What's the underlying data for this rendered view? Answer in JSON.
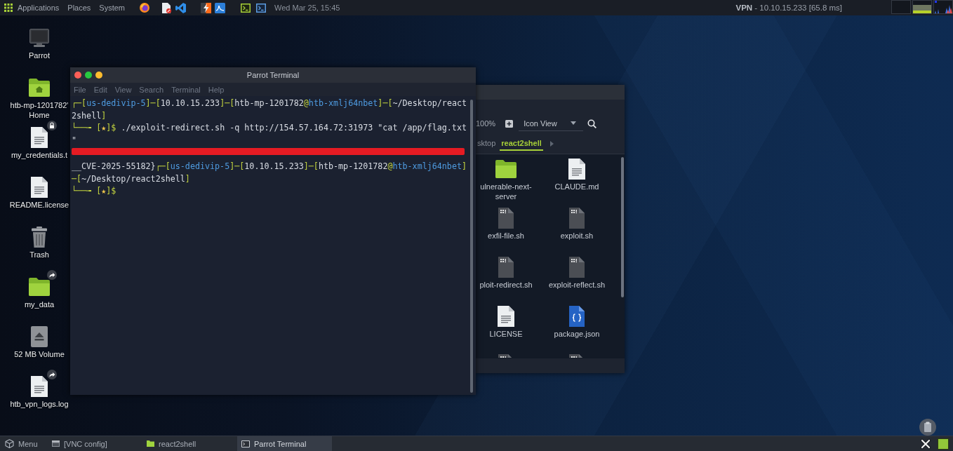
{
  "top_panel": {
    "menus": [
      "Applications",
      "Places",
      "System"
    ],
    "clock": "Wed Mar 25, 15:45",
    "vpn_status": "**VPN** - 10.10.15.233 [65.8 ms]"
  },
  "desktop_icons": [
    {
      "label": "Parrot",
      "kind": "computer",
      "locked": false,
      "linked": false
    },
    {
      "label": "htb-mp-1201782' Home",
      "kind": "home",
      "locked": false,
      "linked": false
    },
    {
      "label": "my_credentials.t",
      "kind": "document",
      "locked": true,
      "linked": false
    },
    {
      "label": "README.license",
      "kind": "document",
      "locked": false,
      "linked": false
    },
    {
      "label": "Trash",
      "kind": "trash",
      "locked": false,
      "linked": false
    },
    {
      "label": "my_data",
      "kind": "folder",
      "locked": false,
      "linked": true
    },
    {
      "label": "52 MB Volume",
      "kind": "volume",
      "locked": false,
      "linked": false
    },
    {
      "label": "htb_vpn_logs.log",
      "kind": "document",
      "locked": false,
      "linked": true
    }
  ],
  "terminal": {
    "title": "Parrot Terminal",
    "menu": [
      "File",
      "Edit",
      "View",
      "Search",
      "Terminal",
      "Help"
    ],
    "lines": [
      {
        "kind": "text",
        "segments": [
          {
            "kind": "frame",
            "text": "┌─["
          },
          {
            "kind": "host",
            "text": "us-dedivip-5"
          },
          {
            "kind": "frame",
            "text": "]─["
          },
          {
            "kind": "plain",
            "text": "10.10.15.233"
          },
          {
            "kind": "frame",
            "text": "]─["
          },
          {
            "kind": "plain",
            "text": "htb-mp-1201782"
          },
          {
            "kind": "frame",
            "text": "@"
          },
          {
            "kind": "host",
            "text": "htb-xmlj64nbet"
          },
          {
            "kind": "frame",
            "text": "]─["
          },
          {
            "kind": "plain",
            "text": "~/Desktop/react"
          }
        ]
      },
      {
        "kind": "text",
        "segments": [
          {
            "kind": "plain",
            "text": "2shell"
          },
          {
            "kind": "frame",
            "text": "]"
          }
        ]
      },
      {
        "kind": "text",
        "segments": [
          {
            "kind": "frame",
            "text": "└──╼ ["
          },
          {
            "kind": "star",
            "text": "★"
          },
          {
            "kind": "frame",
            "text": "]$"
          },
          {
            "kind": "plain",
            "text": " ./exploit-redirect.sh -q http://154.57.164.72:31973 \"cat /app/flag.txt"
          }
        ]
      },
      {
        "kind": "text",
        "segments": [
          {
            "kind": "plain",
            "text": "\""
          }
        ]
      },
      {
        "kind": "redacted"
      },
      {
        "kind": "text",
        "segments": [
          {
            "kind": "plain",
            "text": "__CVE-2025-55182}"
          },
          {
            "kind": "frame",
            "text": "┌─["
          },
          {
            "kind": "host",
            "text": "us-dedivip-5"
          },
          {
            "kind": "frame",
            "text": "]─["
          },
          {
            "kind": "plain",
            "text": "10.10.15.233"
          },
          {
            "kind": "frame",
            "text": "]─["
          },
          {
            "kind": "plain",
            "text": "htb-mp-1201782"
          },
          {
            "kind": "frame",
            "text": "@"
          },
          {
            "kind": "host",
            "text": "htb-xmlj64nbet"
          },
          {
            "kind": "frame",
            "text": "]"
          }
        ]
      },
      {
        "kind": "text",
        "segments": [
          {
            "kind": "frame",
            "text": "─["
          },
          {
            "kind": "plain",
            "text": "~/Desktop/react2shell"
          },
          {
            "kind": "frame",
            "text": "]"
          }
        ]
      },
      {
        "kind": "text",
        "segments": [
          {
            "kind": "frame",
            "text": "└──╼ ["
          },
          {
            "kind": "star",
            "text": "★"
          },
          {
            "kind": "frame",
            "text": "]$"
          }
        ]
      }
    ]
  },
  "file_manager": {
    "zoom": "100%",
    "view": "Icon View",
    "path": [
      {
        "label": "sktop",
        "selected": false
      },
      {
        "label": "react2shell",
        "selected": true
      }
    ],
    "items": [
      {
        "label": "ulnerable-next-server",
        "kind": "folder"
      },
      {
        "label": "CLAUDE.md",
        "kind": "document"
      },
      {
        "label": "exfil-file.sh",
        "kind": "script"
      },
      {
        "label": "exploit.sh",
        "kind": "script"
      },
      {
        "label": "ploit-redirect.sh",
        "kind": "script"
      },
      {
        "label": "exploit-reflect.sh",
        "kind": "script"
      },
      {
        "label": "LICENSE",
        "kind": "document"
      },
      {
        "label": "package.json",
        "kind": "json"
      },
      {
        "kind": "script"
      },
      {
        "kind": "script"
      }
    ]
  },
  "taskbar": {
    "menu": "Menu",
    "tasks": [
      {
        "label": "[VNC config]",
        "kind": "window",
        "selected": false
      },
      {
        "label": "react2shell",
        "kind": "folder",
        "selected": false
      },
      {
        "label": "Parrot Terminal",
        "kind": "terminal",
        "selected": true
      }
    ]
  }
}
